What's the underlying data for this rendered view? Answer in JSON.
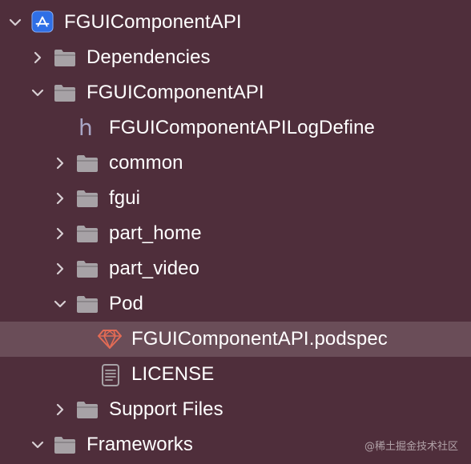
{
  "colors": {
    "background": "#4f2e3b",
    "selection": "#6a4d58",
    "folder": "#a7a2a6",
    "app_icon": "#3b82f6",
    "ruby_icon": "#e36b55"
  },
  "tree": {
    "project": {
      "label": "FGUIComponentAPI",
      "icon": "app-icon",
      "expanded": true
    },
    "dependencies": {
      "label": "Dependencies",
      "icon": "folder-icon",
      "expanded": false
    },
    "group": {
      "label": "FGUIComponentAPI",
      "icon": "folder-icon",
      "expanded": true
    },
    "log_define": {
      "label": "FGUIComponentAPILogDefine",
      "icon": "header-file-icon"
    },
    "common": {
      "label": "common",
      "icon": "folder-icon",
      "expanded": false
    },
    "fgui": {
      "label": "fgui",
      "icon": "folder-icon",
      "expanded": false
    },
    "part_home": {
      "label": "part_home",
      "icon": "folder-icon",
      "expanded": false
    },
    "part_video": {
      "label": "part_video",
      "icon": "folder-icon",
      "expanded": false
    },
    "pod": {
      "label": "Pod",
      "icon": "folder-icon",
      "expanded": true
    },
    "podspec": {
      "label": "FGUIComponentAPI.podspec",
      "icon": "ruby-gem-icon",
      "selected": true
    },
    "license": {
      "label": "LICENSE",
      "icon": "text-document-icon"
    },
    "support_files": {
      "label": "Support Files",
      "icon": "folder-icon",
      "expanded": false
    },
    "frameworks": {
      "label": "Frameworks",
      "icon": "folder-icon",
      "expanded": true
    }
  },
  "watermark": "@稀土掘金技术社区"
}
